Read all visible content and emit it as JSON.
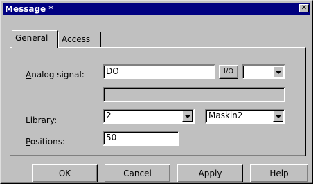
{
  "window": {
    "title": "Message *",
    "close_glyph": "✕"
  },
  "tabs": [
    {
      "label": "General",
      "active": true
    },
    {
      "label": "Access",
      "active": false
    }
  ],
  "form": {
    "analog_signal": {
      "label_prefix": "",
      "label_mnemonic": "A",
      "label_rest": "nalog signal:",
      "value": "DO"
    },
    "io_button": "I/O",
    "io_combo_value": "",
    "description_value": "",
    "library": {
      "label_mnemonic": "L",
      "label_rest": "ibrary:",
      "value": "2",
      "second_value": "Maskin2"
    },
    "positions": {
      "label_mnemonic": "P",
      "label_rest": "ositions:",
      "value": "50"
    }
  },
  "buttons": {
    "ok": "OK",
    "cancel": "Cancel",
    "apply": "Apply",
    "help": "Help"
  }
}
